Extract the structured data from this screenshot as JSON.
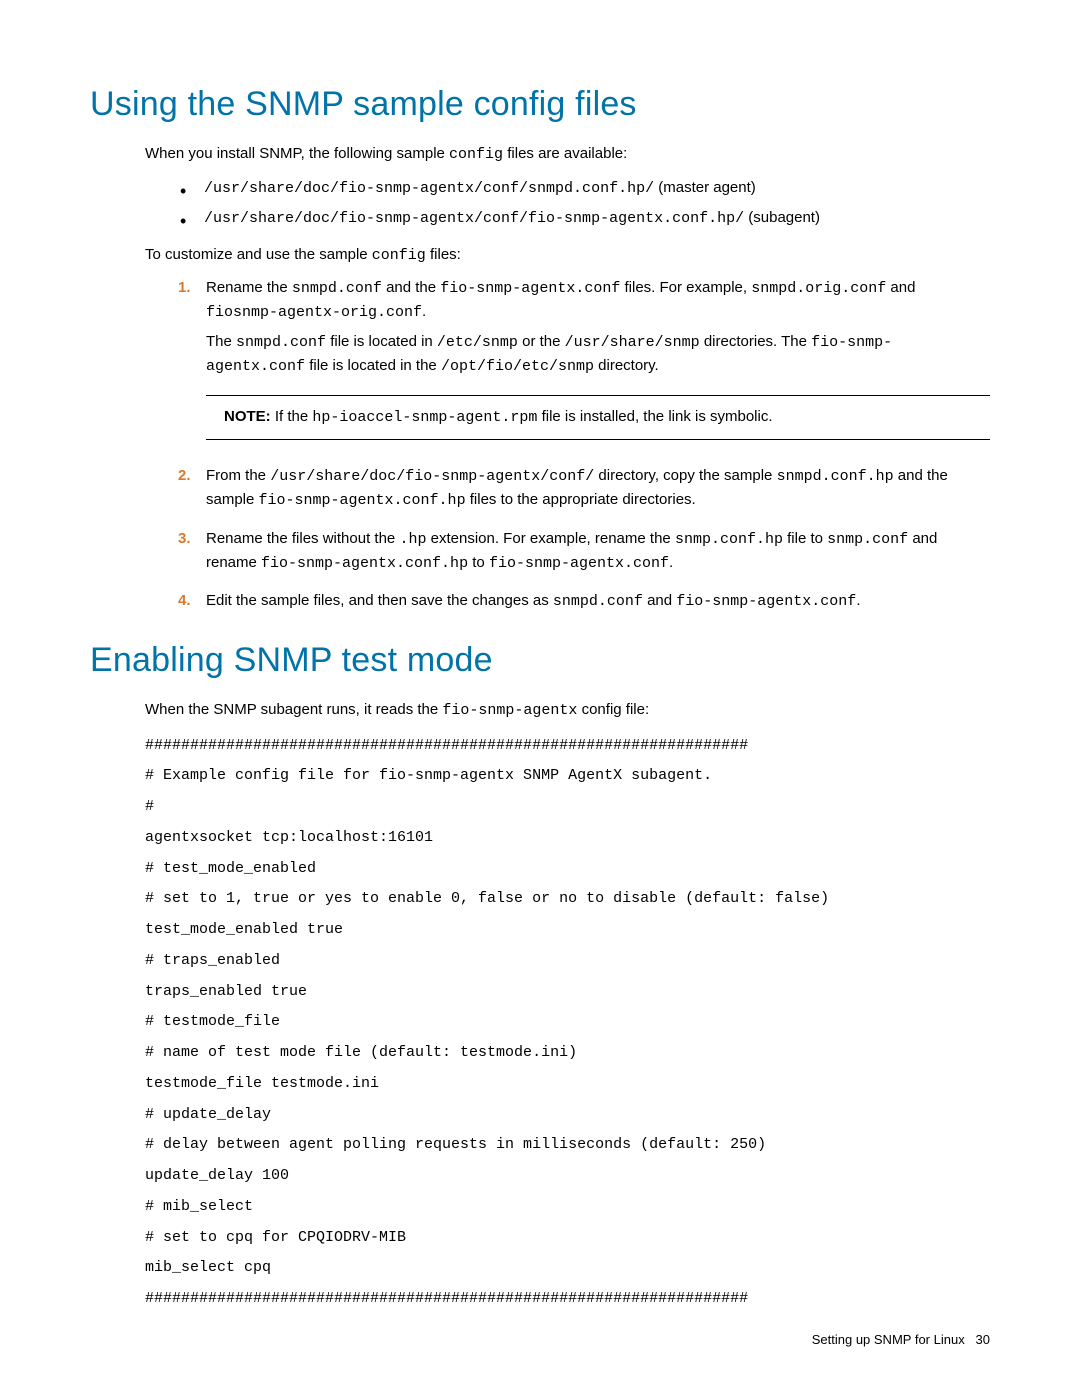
{
  "section1": {
    "heading": "Using the SNMP sample config files",
    "intro_pre": "When you install SNMP, the following sample ",
    "intro_code": "config",
    "intro_post": " files are available:",
    "bullets": [
      {
        "path": "/usr/share/doc/fio-snmp-agentx/conf/snmpd.conf.hp/",
        "label": " (master agent)"
      },
      {
        "path": "/usr/share/doc/fio-snmp-agentx/conf/fio-snmp-agentx.conf.hp/",
        "label": " (subagent)"
      }
    ],
    "customize_pre": "To customize and use the sample ",
    "customize_code": "config",
    "customize_post": " files:",
    "steps": {
      "s1": {
        "l1_a": "Rename the ",
        "l1_b": "snmpd.conf",
        "l1_c": " and the ",
        "l1_d": "fio-snmp-agentx.conf",
        "l1_e": " files. For example, ",
        "l1_f": "snmpd.orig.conf",
        "l1_g": " and ",
        "l1_h": "fiosnmp-agentx-orig.conf",
        "l1_i": ".",
        "l2_a": "The ",
        "l2_b": "snmpd.conf",
        "l2_c": " file is located in ",
        "l2_d": "/etc/snmp",
        "l2_e": " or the ",
        "l2_f": "/usr/share/snmp",
        "l2_g": " directories. The ",
        "l2_h": "fio-snmp-agentx.conf",
        "l2_i": " file is located in the ",
        "l2_j": "/opt/fio/etc/snmp",
        "l2_k": " directory."
      },
      "note": {
        "label": "NOTE:   ",
        "a": "If the ",
        "b": "hp-ioaccel-snmp-agent.rpm",
        "c": " file is installed, the link is symbolic."
      },
      "s2": {
        "a": "From the ",
        "b": "/usr/share/doc/fio-snmp-agentx/conf/",
        "c": " directory, copy the sample ",
        "d": "snmpd.conf.hp",
        "e": " and the sample ",
        "f": "fio-snmp-agentx.conf.hp",
        "g": " files to the appropriate directories."
      },
      "s3": {
        "a": "Rename the files without the ",
        "b": ".hp",
        "c": " extension. For example, rename the ",
        "d": "snmp.conf.hp",
        "e": " file to ",
        "f": "snmp.conf",
        "g": " and rename ",
        "h": "fio-snmp-agentx.conf.hp",
        "i": " to ",
        "j": "fio-snmp-agentx.conf",
        "k": "."
      },
      "s4": {
        "a": "Edit the sample files, and then save the changes as ",
        "b": "snmpd.conf",
        "c": " and ",
        "d": "fio-snmp-agentx.conf",
        "e": "."
      }
    }
  },
  "section2": {
    "heading": "Enabling SNMP test mode",
    "intro_pre": "When the SNMP subagent runs, it reads the ",
    "intro_code": "fio-snmp-agentx",
    "intro_post": " config file:",
    "config": "###################################################################\n# Example config file for fio-snmp-agentx SNMP AgentX subagent.\n#\nagentxsocket tcp:localhost:16101\n# test_mode_enabled\n# set to 1, true or yes to enable 0, false or no to disable (default: false) test_mode_enabled true\n# traps_enabled\ntraps_enabled true\n# testmode_file\n# name of test mode file (default: testmode.ini)\ntestmode_file testmode.ini\n# update_delay\n# delay between agent polling requests in milliseconds (default: 250)\nupdate_delay 100\n# mib_select\n# set to cpq for CPQIODRV-MIB\nmib_select cpq\n###################################################################"
  },
  "footer": {
    "text": "Setting up SNMP for Linux",
    "page": "30"
  }
}
